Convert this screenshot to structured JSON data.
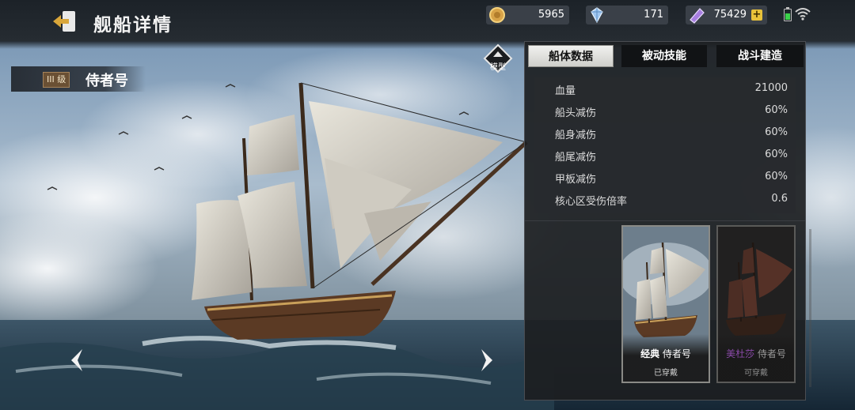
{
  "header": {
    "title": "舰船详情"
  },
  "resources": [
    {
      "icon": "gold-coin-icon",
      "value": "5965"
    },
    {
      "icon": "diamond-icon",
      "value": "171"
    },
    {
      "icon": "purple-crystal-icon",
      "value": "75429",
      "plus": "+"
    }
  ],
  "ship": {
    "grade": "III 级",
    "name": "侍者号"
  },
  "model_button": {
    "label": "模型"
  },
  "tabs": [
    {
      "label": "船体数据",
      "active": true
    },
    {
      "label": "被动技能",
      "active": false
    },
    {
      "label": "战斗建造",
      "active": false
    }
  ],
  "stats": [
    {
      "label": "血量",
      "value": "21000"
    },
    {
      "label": "船头减伤",
      "value": "60%"
    },
    {
      "label": "船身减伤",
      "value": "60%"
    },
    {
      "label": "船尾减伤",
      "value": "60%"
    },
    {
      "label": "甲板减伤",
      "value": "60%"
    },
    {
      "label": "核心区受伤倍率",
      "value": "0.6"
    }
  ],
  "skins": [
    {
      "prefix": "经典",
      "name": "侍者号",
      "status": "已穿戴"
    },
    {
      "prefix": "美杜莎",
      "name": "侍者号",
      "status": "可穿戴"
    }
  ],
  "colors": {
    "accent_gold": "#e8c23a",
    "panel_bg": "#1c1e21",
    "tab_active": "#e8e8e4"
  }
}
